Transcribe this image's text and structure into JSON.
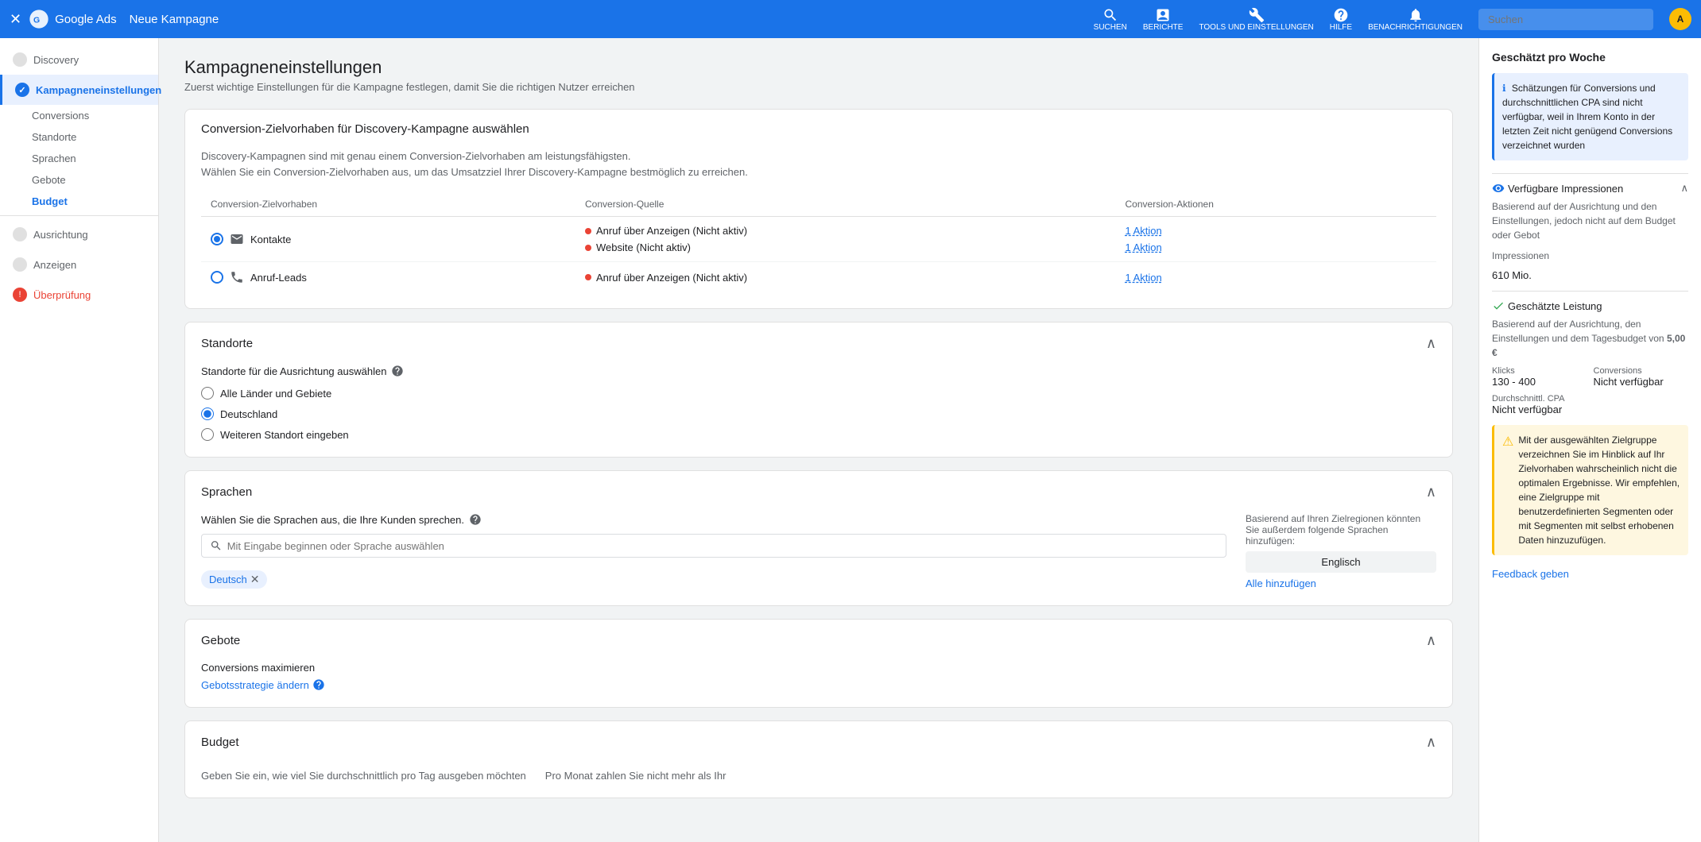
{
  "topnav": {
    "app_name": "Google Ads",
    "campaign": "Neue Kampagne",
    "search_placeholder": "Suchen",
    "nav_items": [
      {
        "label": "SUCHEN",
        "icon": "search"
      },
      {
        "label": "BERICHTE",
        "icon": "bar-chart"
      },
      {
        "label": "TOOLS UND EINSTELLUNGEN",
        "icon": "wrench"
      },
      {
        "label": "HILFE",
        "icon": "question"
      },
      {
        "label": "BENACHRICHTIGUNGEN",
        "icon": "bell"
      }
    ],
    "avatar": "A"
  },
  "sidebar": {
    "discovery_label": "Discovery",
    "items": [
      {
        "label": "Kampagneneinstellungen",
        "status": "active",
        "icon": "check"
      },
      {
        "label": "Conversions",
        "status": "sub",
        "icon": ""
      },
      {
        "label": "Standorte",
        "status": "sub",
        "icon": ""
      },
      {
        "label": "Sprachen",
        "status": "sub",
        "icon": ""
      },
      {
        "label": "Gebote",
        "status": "sub",
        "icon": ""
      },
      {
        "label": "Budget",
        "status": "sub-active",
        "icon": ""
      }
    ],
    "ausrichtung_label": "Ausrichtung",
    "anzeigen_label": "Anzeigen",
    "ueberpruefung_label": "Überprüfung"
  },
  "main": {
    "title": "Kampagneneinstellungen",
    "subtitle": "Zuerst wichtige Einstellungen für die Kampagne festlegen, damit Sie die richtigen Nutzer erreichen",
    "conversion_section": {
      "title": "Conversion-Zielvorhaben für Discovery-Kampagne auswählen",
      "description": "Discovery-Kampagnen sind mit genau einem Conversion-Zielvorhaben am leistungsfähigsten.\nWählen Sie ein Conversion-Zielvorhaben aus, um das Umsatzziel Ihrer Discovery-Kampagne bestmöglich zu erreichen.",
      "col_zielvorhaben": "Conversion-Zielvorhaben",
      "col_quelle": "Conversion-Quelle",
      "col_aktionen": "Conversion-Aktionen",
      "rows": [
        {
          "selected": true,
          "label": "Kontakte",
          "sources": [
            {
              "dot": "red",
              "text": "Anruf über Anzeigen (Nicht aktiv)",
              "action": "1 Aktion"
            },
            {
              "dot": "red",
              "text": "Website (Nicht aktiv)",
              "action": "1 Aktion"
            }
          ]
        },
        {
          "selected": false,
          "label": "Anruf-Leads",
          "sources": [
            {
              "dot": "red",
              "text": "Anruf über Anzeigen (Nicht aktiv)",
              "action": "1 Aktion"
            }
          ]
        }
      ]
    },
    "standorte_section": {
      "title": "Standorte",
      "help_label": "Standorte für die Ausrichtung auswählen",
      "options": [
        {
          "value": "alle",
          "label": "Alle Länder und Gebiete",
          "selected": false
        },
        {
          "value": "deutschland",
          "label": "Deutschland",
          "selected": true
        },
        {
          "value": "weiterer",
          "label": "Weiteren Standort eingeben",
          "selected": false
        }
      ]
    },
    "sprachen_section": {
      "title": "Sprachen",
      "help_text": "Wählen Sie die Sprachen aus, die Ihre Kunden sprechen.",
      "search_placeholder": "Mit Eingabe beginnen oder Sprache auswählen",
      "selected_tags": [
        "Deutsch"
      ],
      "suggested_label": "Basierend auf Ihren Zielregionen könnten Sie außerdem folgende Sprachen hinzufügen:",
      "suggested_langs": [
        "Englisch"
      ],
      "add_all_label": "Alle hinzufügen"
    },
    "gebote_section": {
      "title": "Gebote",
      "strategy_label": "Conversions maximieren",
      "change_link": "Gebotsstrategie ändern"
    },
    "budget_section": {
      "title": "Budget",
      "desc": "Geben Sie ein, wie viel Sie durchschnittlich pro Tag ausgeben möchten",
      "note": "Pro Monat zahlen Sie nicht mehr als Ihr"
    }
  },
  "right_panel": {
    "title": "Geschätzt pro Woche",
    "info_text": "Schätzungen für Conversions und durchschnittlichen CPA sind nicht verfügbar, weil in Ihrem Konto in der letzten Zeit nicht genügend Conversions verzeichnet wurden",
    "impressions_section": {
      "title": "Verfügbare Impressionen",
      "description": "Basierend auf der Ausrichtung und den Einstellungen, jedoch nicht auf dem Budget oder Gebot",
      "impressions_label": "Impressionen",
      "impressions_value": "610 Mio."
    },
    "performance_section": {
      "title": "Geschätzte Leistung",
      "description": "Basierend auf der Ausrichtung, den Einstellungen und dem Tagesbudget von",
      "budget_amount": "5,00 €",
      "klicks_label": "Klicks",
      "klicks_value": "130 - 400",
      "conversions_label": "Conversions",
      "conversions_value": "Nicht verfügbar",
      "cpa_label": "Durchschnittl. CPA",
      "cpa_value": "Nicht verfügbar"
    },
    "warning_text": "Mit der ausgewählten Zielgruppe verzeichnen Sie im Hinblick auf Ihr Zielvorhaben wahrscheinlich nicht die optimalen Ergebnisse. Wir empfehlen, eine Zielgruppe mit benutzerdefinierten Segmenten oder mit Segmenten mit selbst erhobenen Daten hinzuzufügen.",
    "feedback_label": "Feedback geben"
  }
}
